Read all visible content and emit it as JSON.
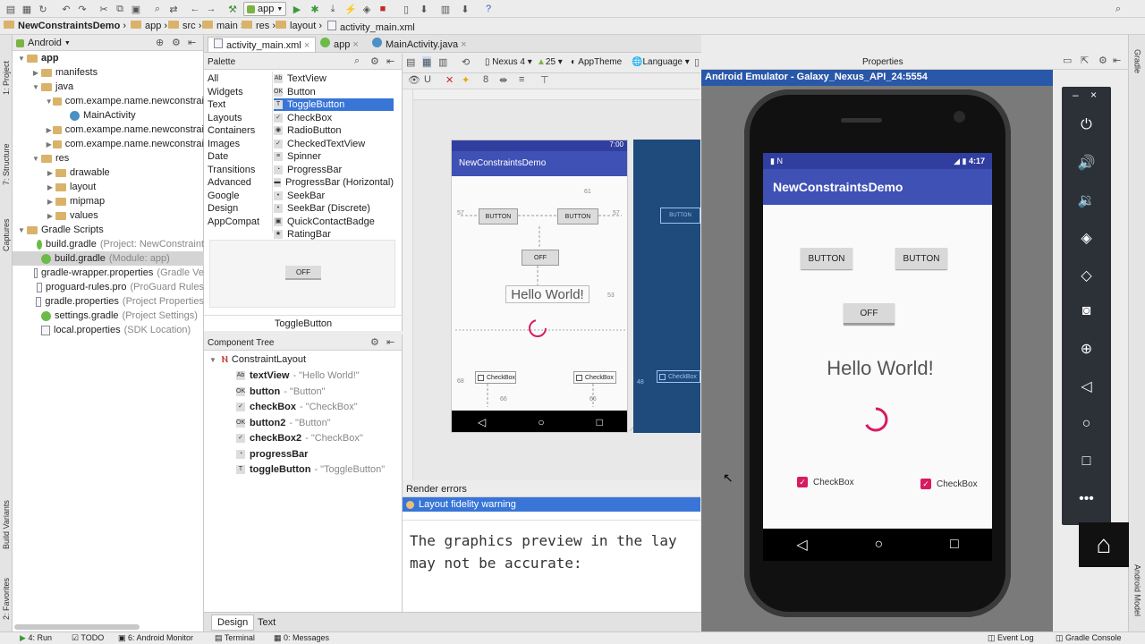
{
  "toolbar": {
    "run_config": "app",
    "icons": [
      "open-icon",
      "save-icon",
      "sync-icon",
      "undo-icon",
      "redo-icon",
      "cut-icon",
      "copy-icon",
      "paste-icon",
      "find-icon",
      "replace-icon",
      "back-icon",
      "forward-icon",
      "build-icon",
      "run-icon",
      "debug-icon",
      "attach-icon",
      "stop-icon",
      "avd-icon",
      "sdk-icon",
      "project-structure-icon",
      "help-icon"
    ]
  },
  "breadcrumb": [
    "NewConstraintsDemo",
    "app",
    "src",
    "main",
    "res",
    "layout",
    "activity_main.xml"
  ],
  "project_panel": {
    "view_mode": "Android",
    "tree": [
      {
        "label": "app",
        "level": 0,
        "bold": true
      },
      {
        "label": "manifests",
        "level": 1
      },
      {
        "label": "java",
        "level": 1
      },
      {
        "label": "com.exampe.name.newconstrai",
        "level": 2
      },
      {
        "label": "MainActivity",
        "level": 3
      },
      {
        "label": "com.exampe.name.newconstrai",
        "level": 2
      },
      {
        "label": "com.exampe.name.newconstrai",
        "level": 2
      },
      {
        "label": "res",
        "level": 1
      },
      {
        "label": "drawable",
        "level": 2
      },
      {
        "label": "layout",
        "level": 2
      },
      {
        "label": "mipmap",
        "level": 2
      },
      {
        "label": "values",
        "level": 2
      },
      {
        "label": "Gradle Scripts",
        "level": 0
      },
      {
        "label": "build.gradle",
        "hint": "(Project: NewConstraint",
        "level": 1
      },
      {
        "label": "build.gradle",
        "hint": "(Module: app)",
        "level": 1,
        "selected": true
      },
      {
        "label": "gradle-wrapper.properties",
        "hint": "(Gradle Ve",
        "level": 1
      },
      {
        "label": "proguard-rules.pro",
        "hint": "(ProGuard Rules",
        "level": 1
      },
      {
        "label": "gradle.properties",
        "hint": "(Project Properties",
        "level": 1
      },
      {
        "label": "settings.gradle",
        "hint": "(Project Settings)",
        "level": 1
      },
      {
        "label": "local.properties",
        "hint": "(SDK Location)",
        "level": 1
      }
    ]
  },
  "left_tabs": [
    "1: Project",
    "7: Structure",
    "Captures",
    "Build Variants",
    "2: Favorites"
  ],
  "right_tabs": [
    "Gradle",
    "Android Model"
  ],
  "editor_tabs": [
    {
      "label": "activity_main.xml",
      "active": true
    },
    {
      "label": "app",
      "active": false
    },
    {
      "label": "MainActivity.java",
      "active": false
    }
  ],
  "palette": {
    "title": "Palette",
    "categories": [
      "All",
      "Widgets",
      "Text",
      "Layouts",
      "Containers",
      "Images",
      "Date",
      "Transitions",
      "Advanced",
      "Google",
      "Design",
      "AppCompat"
    ],
    "items": [
      {
        "label": "TextView",
        "icon": "Ab"
      },
      {
        "label": "Button",
        "icon": "OK"
      },
      {
        "label": "ToggleButton",
        "icon": "T",
        "selected": true
      },
      {
        "label": "CheckBox",
        "icon": "✓"
      },
      {
        "label": "RadioButton",
        "icon": "◉"
      },
      {
        "label": "CheckedTextView",
        "icon": "✓"
      },
      {
        "label": "Spinner",
        "icon": "≡"
      },
      {
        "label": "ProgressBar",
        "icon": "◔"
      },
      {
        "label": "ProgressBar (Horizontal)",
        "icon": "▬"
      },
      {
        "label": "SeekBar",
        "icon": "•"
      },
      {
        "label": "SeekBar (Discrete)",
        "icon": "•"
      },
      {
        "label": "QuickContactBadge",
        "icon": "▣"
      },
      {
        "label": "RatingBar",
        "icon": "★"
      }
    ],
    "preview_button": "OFF",
    "preview_label": "ToggleButton"
  },
  "component_tree": {
    "title": "Component Tree",
    "root": "ConstraintLayout",
    "children": [
      {
        "id": "textView",
        "desc": "- \"Hello World!\"",
        "icon": "Ab"
      },
      {
        "id": "button",
        "desc": "- \"Button\"",
        "icon": "OK"
      },
      {
        "id": "checkBox",
        "desc": "- \"CheckBox\"",
        "icon": "✓"
      },
      {
        "id": "button2",
        "desc": "- \"Button\"",
        "icon": "OK"
      },
      {
        "id": "checkBox2",
        "desc": "- \"CheckBox\"",
        "icon": "✓"
      },
      {
        "id": "progressBar",
        "desc": "",
        "icon": "◔"
      },
      {
        "id": "toggleButton",
        "desc": "- \"ToggleButton\"",
        "icon": "T"
      }
    ]
  },
  "design_toolbar": {
    "device": "Nexus 4",
    "api": "25",
    "theme": "AppTheme",
    "language": "Language"
  },
  "blueprint": {
    "time": "7:00",
    "app_title": "NewConstraintsDemo",
    "button1": "BUTTON",
    "button2": "BUTTON",
    "toggle": "OFF",
    "hello": "Hello World!",
    "checkbox1": "CheckBox",
    "checkbox2": "CheckBox",
    "margins": [
      "57",
      "61",
      "57",
      "53",
      "66",
      "68",
      "66",
      "48"
    ],
    "blue_button": "BUTTON",
    "blue_checkbox": "CheckBox"
  },
  "render_errors": {
    "title": "Render errors",
    "warning": "Layout fidelity warning",
    "message_line1": "The graphics preview in the lay",
    "message_line2": "may not be accurate:"
  },
  "bottom_tabs": [
    "Design",
    "Text"
  ],
  "properties_title": "Properties",
  "emulator": {
    "title": "Android Emulator - Galaxy_Nexus_API_24:5554",
    "time": "4:17",
    "app_title": "NewConstraintsDemo",
    "button1": "BUTTON",
    "button2": "BUTTON",
    "toggle": "OFF",
    "hello": "Hello World!",
    "checkbox1": "CheckBox",
    "checkbox2": "CheckBox",
    "accent_color": "#d81b60",
    "appbar_color": "#3f51b5",
    "status_color": "#303f9f"
  },
  "statusbar": [
    "4: Run",
    "TODO",
    "6: Android Monitor",
    "Terminal",
    "0: Messages",
    "Event Log",
    "Gradle Console"
  ]
}
